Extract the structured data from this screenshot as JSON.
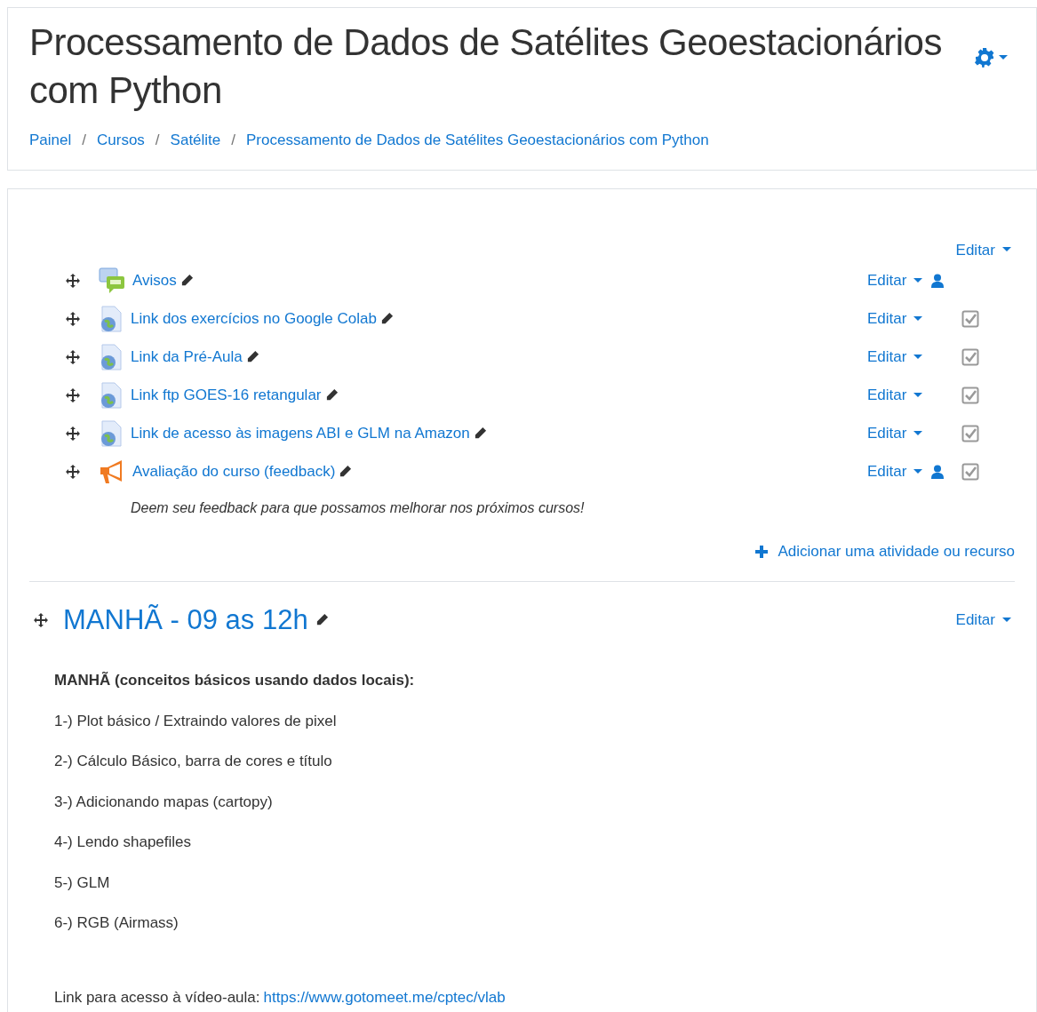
{
  "header": {
    "title": "Processamento de Dados de Satélites Geoestacionários com Python",
    "separator": "/",
    "breadcrumb": [
      "Painel",
      "Cursos",
      "Satélite",
      "Processamento de Dados de Satélites Geoestacionários com Python"
    ]
  },
  "section0": {
    "edit_label": "Editar",
    "activities": [
      {
        "kind": "forum",
        "name": "Avisos",
        "edit_label": "Editar",
        "group_icon": true,
        "completion": false
      },
      {
        "kind": "url",
        "name": "Link dos exercícios no Google Colab",
        "edit_label": "Editar",
        "group_icon": false,
        "completion": true
      },
      {
        "kind": "url",
        "name": "Link da Pré-Aula",
        "edit_label": "Editar",
        "group_icon": false,
        "completion": true
      },
      {
        "kind": "url",
        "name": "Link ftp GOES-16 retangular",
        "edit_label": "Editar",
        "group_icon": false,
        "completion": true
      },
      {
        "kind": "url",
        "name": "Link de acesso às imagens ABI e GLM na Amazon",
        "edit_label": "Editar",
        "group_icon": false,
        "completion": true
      },
      {
        "kind": "feedback",
        "name": "Avaliação do curso (feedback)",
        "edit_label": "Editar",
        "group_icon": true,
        "completion": true,
        "description": "Deem seu feedback para que possamos melhorar nos próximos cursos!"
      }
    ],
    "add_label": "Adicionar uma atividade ou recurso"
  },
  "section1": {
    "title": "MANHÃ - 09 as 12h",
    "edit_label": "Editar",
    "heading": "MANHÃ (conceitos básicos usando dados locais):",
    "items": [
      "1-) Plot básico / Extraindo valores de pixel",
      "2-) Cálculo Básico, barra de cores e título",
      "3-) Adicionando mapas (cartopy)",
      "4-) Lendo shapefiles",
      "5-) GLM",
      "6-) RGB (Airmass)"
    ],
    "link_prefix": "Link para acesso à vídeo-aula:",
    "link": "https://www.gotomeet.me/cptec/vlab"
  }
}
